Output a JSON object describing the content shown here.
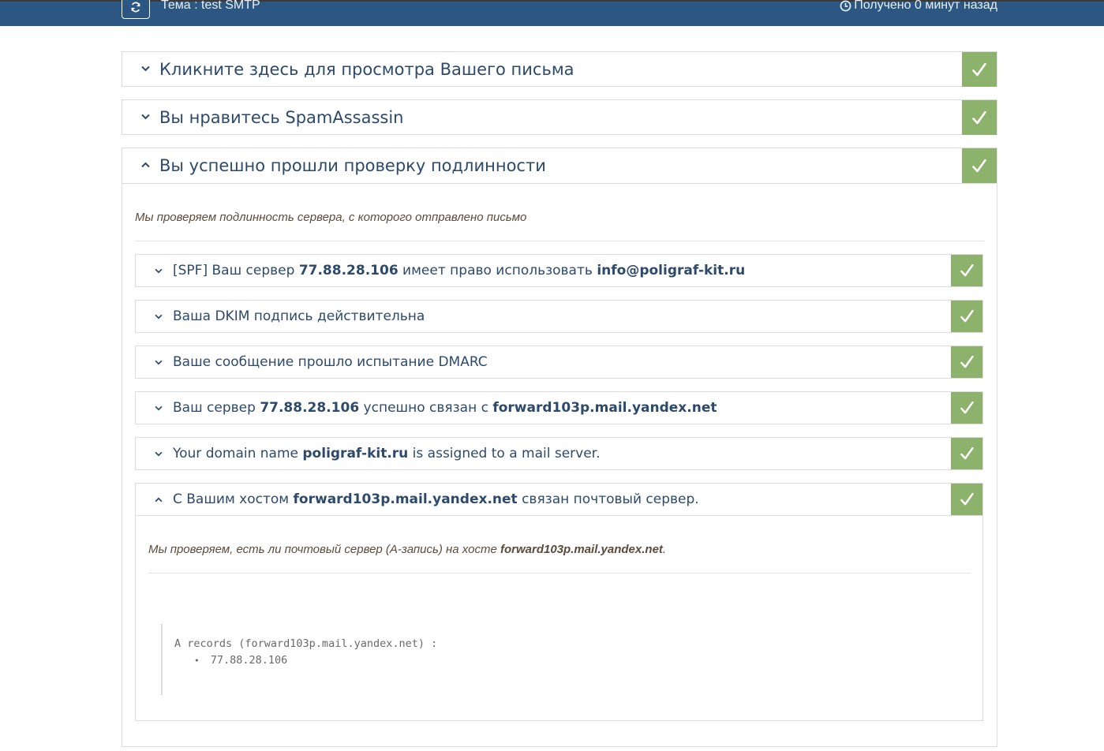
{
  "header": {
    "subject_label": "Тема : test SMTP",
    "received_label": "Получено 0 минут назад"
  },
  "colors": {
    "topbar": "#2b5782",
    "check": "#8db26b",
    "title": "#2d4a6b"
  },
  "panels": [
    {
      "title": "Кликните здесь для просмотра Вашего письма",
      "expanded": false
    },
    {
      "title": "Вы нравитесь SpamAssassin",
      "expanded": false
    },
    {
      "title": "Вы успешно прошли проверку подлинности",
      "expanded": true,
      "lead": "Мы проверяем подлинность сервера, с которого отправлено письмо"
    }
  ],
  "checks": [
    {
      "pre": "[SPF] Ваш сервер ",
      "b1": "77.88.28.106",
      "mid": " имеет право использовать ",
      "b2": "info@poligraf-kit.ru",
      "post": ""
    },
    {
      "pre": "Ваша DKIM подпись действительна",
      "b1": "",
      "mid": "",
      "b2": "",
      "post": ""
    },
    {
      "pre": "Ваше сообщение прошло испытание DMARC",
      "b1": "",
      "mid": "",
      "b2": "",
      "post": ""
    },
    {
      "pre": "Ваш сервер ",
      "b1": "77.88.28.106",
      "mid": " успешно связан с ",
      "b2": "forward103p.mail.yandex.net",
      "post": ""
    },
    {
      "pre": "Your domain name ",
      "b1": "poligraf-kit.ru",
      "mid": " is assigned to a mail server.",
      "b2": "",
      "post": ""
    },
    {
      "pre": "С Вашим хостом ",
      "b1": "forward103p.mail.yandex.net",
      "mid": " связан почтовый сервер.",
      "b2": "",
      "post": ""
    }
  ],
  "host_check": {
    "lead_pre": "Мы проверяем, есть ли почтовый сервер (A-запись) на хосте ",
    "lead_host": "forward103p.mail.yandex.net",
    "lead_post": ".",
    "records_label": "A records (forward103p.mail.yandex.net) :",
    "records": [
      "77.88.28.106"
    ]
  }
}
